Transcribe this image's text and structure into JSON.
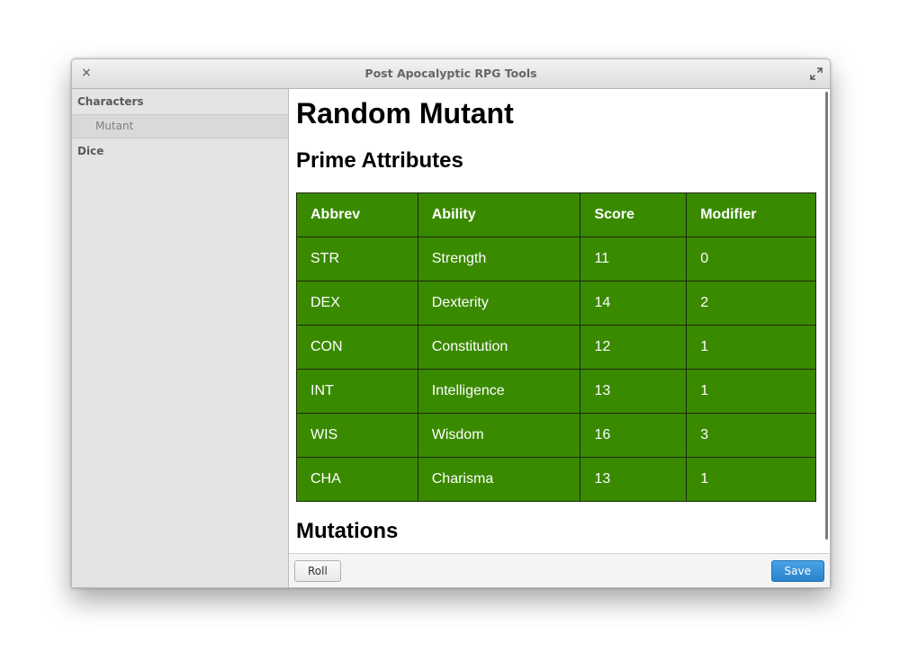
{
  "window": {
    "title": "Post Apocalyptic RPG Tools",
    "close_glyph": "×",
    "close_icon": "close-icon",
    "maximize_icon": "maximize-icon"
  },
  "sidebar": {
    "sections": [
      {
        "label": "Characters",
        "items": [
          {
            "label": "Mutant",
            "selected": true
          }
        ]
      },
      {
        "label": "Dice",
        "items": []
      }
    ]
  },
  "main": {
    "title": "Random Mutant",
    "attributes_heading": "Prime Attributes",
    "table": {
      "columns": [
        "Abbrev",
        "Ability",
        "Score",
        "Modifier"
      ],
      "rows": [
        [
          "STR",
          "Strength",
          "11",
          "0"
        ],
        [
          "DEX",
          "Dexterity",
          "14",
          "2"
        ],
        [
          "CON",
          "Constitution",
          "12",
          "1"
        ],
        [
          "INT",
          "Intelligence",
          "13",
          "1"
        ],
        [
          "WIS",
          "Wisdom",
          "16",
          "3"
        ],
        [
          "CHA",
          "Charisma",
          "13",
          "1"
        ]
      ]
    },
    "mutations_heading": "Mutations"
  },
  "footer": {
    "roll_label": "Roll",
    "save_label": "Save"
  },
  "colors": {
    "table_bg": "#3a8a00",
    "save_accent": "#2a82cc"
  }
}
